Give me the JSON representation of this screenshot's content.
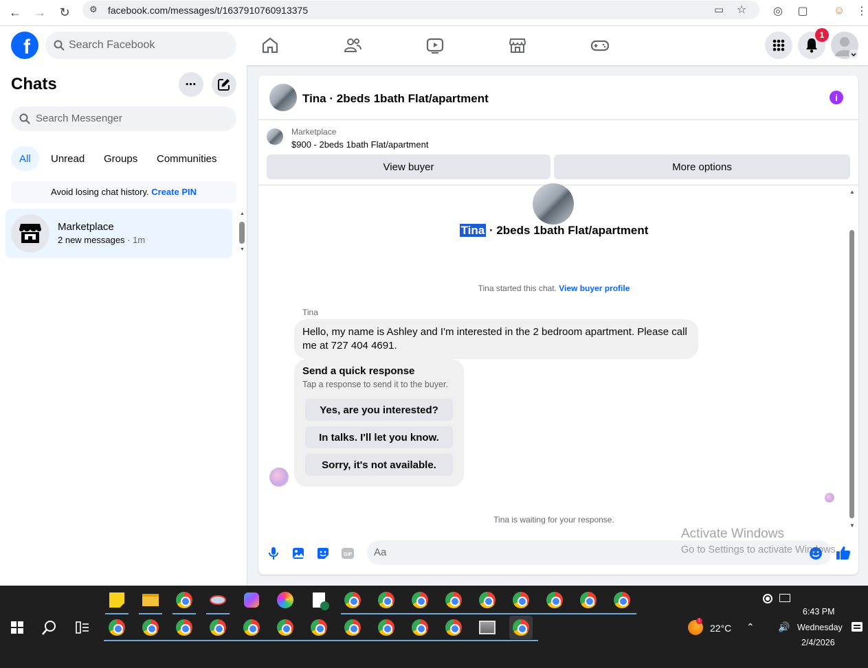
{
  "browser": {
    "url": "facebook.com/messages/t/1637910760913375"
  },
  "header": {
    "search_placeholder": "Search Facebook",
    "notification_count": "1",
    "nav": [
      "home-icon",
      "friends-icon",
      "video-icon",
      "marketplace-icon",
      "gaming-icon"
    ]
  },
  "sidebar": {
    "title": "Chats",
    "search_placeholder": "Search Messenger",
    "filters": [
      "All",
      "Unread",
      "Groups",
      "Communities"
    ],
    "pin_notice": "Avoid losing chat history.",
    "pin_link": "Create PIN",
    "chats": [
      {
        "name": "Marketplace",
        "preview": "2 new messages",
        "time": "· 1m"
      }
    ]
  },
  "conversation": {
    "title": "Tina · 2beds 1bath Flat/apartment",
    "marketplace_label": "Marketplace",
    "listing": "$900 - 2beds 1bath Flat/apartment",
    "view_buyer": "View buyer",
    "more_options": "More options",
    "thread_name_highlight": "Tina",
    "thread_name_rest": " · 2beds 1bath Flat/apartment",
    "started_text": "Tina started this chat.",
    "started_link": "View buyer profile",
    "sender": "Tina",
    "message": "Hello, my name is Ashley and I'm interested in the 2 bedroom apartment. Please call me at 727 404 4691.",
    "quick_title": "Send a quick response",
    "quick_subtitle": "Tap a response to send it to the buyer.",
    "quick_replies": [
      "Yes, are you interested?",
      "In talks. I'll let you know.",
      "Sorry, it's not available."
    ],
    "waiting": "Tina is waiting for your response.",
    "composer_placeholder": "Aa"
  },
  "watermark": {
    "line1": "Activate Windows",
    "line2": "Go to Settings to activate Windows."
  },
  "taskbar": {
    "weather": "22°C",
    "time": "6:43 PM",
    "day": "Wednesday",
    "date": "2/4/2026"
  },
  "colors": {
    "fb_blue": "#0866ff",
    "info_purple": "#a033ff",
    "badge_red": "#e41e3f"
  }
}
